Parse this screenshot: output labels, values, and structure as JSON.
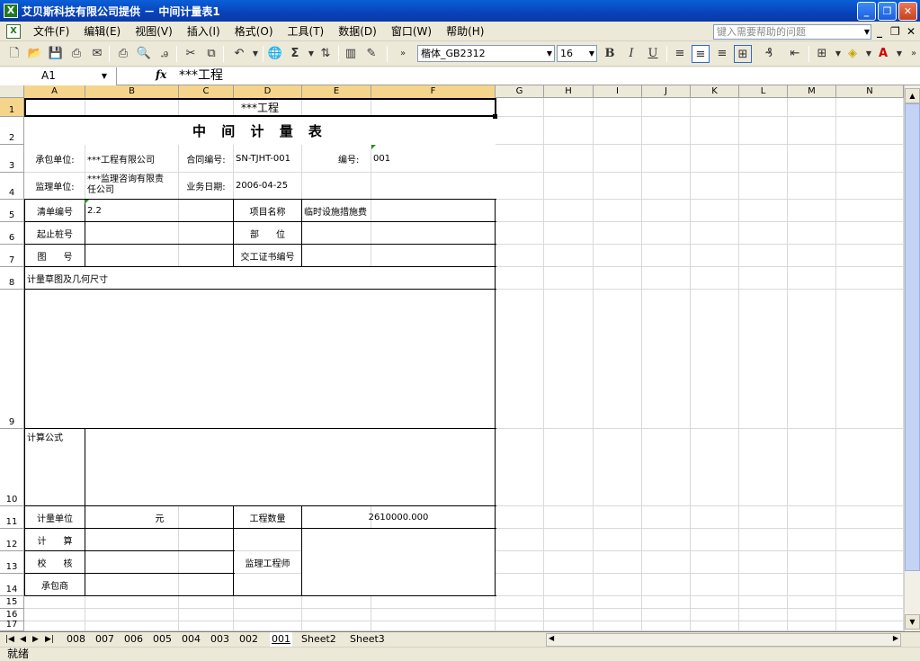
{
  "window": {
    "title": "艾贝斯科技有限公司提供 － 中间计量表1",
    "app_icon": "excel-icon",
    "buttons": [
      "minimize-icon",
      "restore-icon",
      "close-icon"
    ]
  },
  "menubar": {
    "items": [
      "文件(F)",
      "编辑(E)",
      "视图(V)",
      "插入(I)",
      "格式(O)",
      "工具(T)",
      "数据(D)",
      "窗口(W)",
      "帮助(H)"
    ],
    "help_placeholder": "键入需要帮助的问题"
  },
  "toolbar": {
    "font_name": "楷体_GB2312",
    "font_size": "16",
    "bold": "B",
    "italic": "I",
    "underline": "U",
    "sum": "Σ"
  },
  "formula_bar": {
    "name_box": "A1",
    "fx": "fx",
    "content": "***工程"
  },
  "columns": [
    "A",
    "B",
    "C",
    "D",
    "E",
    "F",
    "G",
    "H",
    "I",
    "J",
    "K",
    "L",
    "M",
    "N"
  ],
  "rows": [
    "1",
    "2",
    "3",
    "4",
    "5",
    "6",
    "7",
    "8",
    "9",
    "10",
    "11",
    "12",
    "13",
    "14",
    "15",
    "16",
    "17"
  ],
  "form": {
    "title_line": "***工程",
    "heading": "中 间 计 量 表",
    "contractor_label": "承包单位:",
    "contractor_value": "***工程有限公司",
    "contract_no_label": "合同编号:",
    "contract_no_value": "SN-TJHT-001",
    "number_label": "编号:",
    "number_value": "001",
    "supervisor_label": "监理单位:",
    "supervisor_value_line1": "***监理咨询有限责",
    "supervisor_value_line2": "任公司",
    "date_label": "业务日期:",
    "date_value": "2006-04-25",
    "list_no_label": "清单编号",
    "list_no_value": "2.2",
    "item_name_label": "项目名称",
    "item_name_value": "临时设施措施费",
    "station_label": "起止桩号",
    "part_label": "部      位",
    "drawing_label": "图      号",
    "cert_label": "交工证书编号",
    "sketch_label": "计量草图及几何尺寸",
    "formula_label": "计算公式",
    "unit_label": "计量单位",
    "unit_value": "元",
    "quantity_label": "工程数量",
    "quantity_value": "2610000.000",
    "calc_label": "计      算",
    "check_label": "校      核",
    "contractor_sign_label": "承包商",
    "engineer_label": "监理工程师"
  },
  "sheet_tabs": [
    "008",
    "007",
    "006",
    "005",
    "004",
    "003",
    "002",
    "001",
    "Sheet2",
    "Sheet3"
  ],
  "active_tab": "001",
  "status": "就绪",
  "colors": {
    "titlebar": "#0842b8",
    "chrome": "#ece9d8",
    "header_selected": "#f5d58c"
  }
}
